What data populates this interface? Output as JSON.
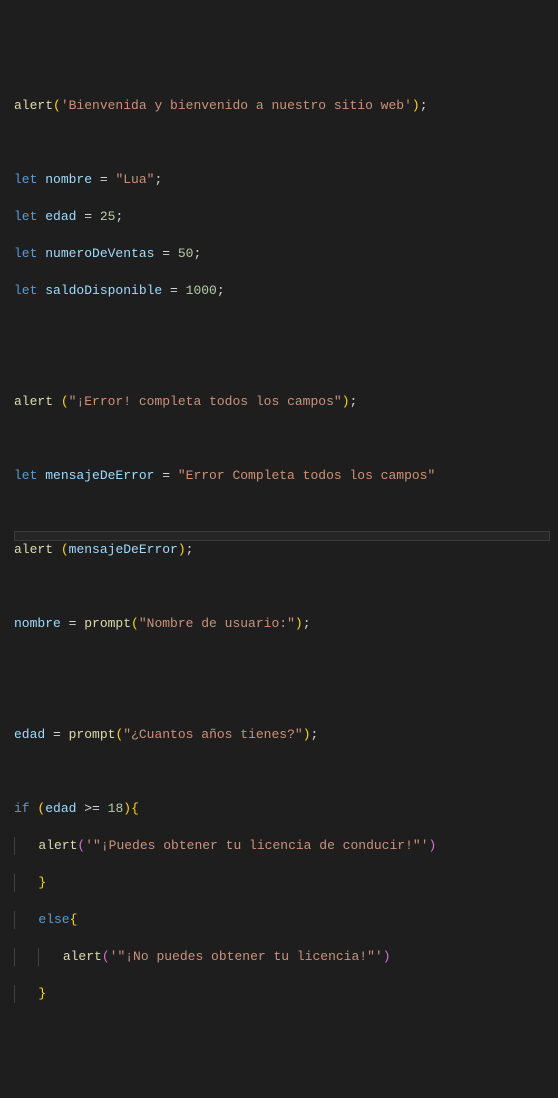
{
  "code": {
    "l1_fn": "alert",
    "l1_p1": "(",
    "l1_str": "'Bienvenida y bienvenido a nuestro sitio web'",
    "l1_p2": ")",
    "l1_s": ";",
    "l3_kw": "let",
    "l3_var": "nombre",
    "l3_eq": " = ",
    "l3_str": "\"Lua\"",
    "l3_s": ";",
    "l4_kw": "let",
    "l4_var": "edad",
    "l4_eq": " = ",
    "l4_num": "25",
    "l4_s": ";",
    "l5_kw": "let",
    "l5_var": "numeroDeVentas",
    "l5_eq": " = ",
    "l5_num": "50",
    "l5_s": ";",
    "l6_kw": "let",
    "l6_var": "saldoDisponible",
    "l6_eq": " = ",
    "l6_num": "1000",
    "l6_s": ";",
    "l9_fn": "alert",
    "l9_sp": " ",
    "l9_p1": "(",
    "l9_str": "\"¡Error! completa todos los campos\"",
    "l9_p2": ")",
    "l9_s": ";",
    "l11_kw": "let",
    "l11_var": "mensajeDeError",
    "l11_eq": " = ",
    "l11_str": "\"Error Completa todos los campos\"",
    "l13_fn": "alert",
    "l13_sp": " ",
    "l13_p1": "(",
    "l13_var": "mensajeDeError",
    "l13_p2": ")",
    "l13_s": ";",
    "l15_var": "nombre",
    "l15_eq": " = ",
    "l15_fn": "prompt",
    "l15_p1": "(",
    "l15_str": "\"Nombre de usuario:\"",
    "l15_p2": ")",
    "l15_s": ";",
    "l18_var": "edad",
    "l18_eq": " = ",
    "l18_fn": "prompt",
    "l18_p1": "(",
    "l18_str": "\"¿Cuantos años tienes?\"",
    "l18_p2": ")",
    "l18_s": ";",
    "l20_if": "if",
    "l20_sp": " ",
    "l20_p1": "(",
    "l20_var": "edad",
    "l20_op": " >= ",
    "l20_num": "18",
    "l20_p2": ")",
    "l20_b1": "{",
    "l21_fn": "alert",
    "l21_p1": "(",
    "l21_str": "'\"¡Puedes obtener tu licencia de conducir!\"'",
    "l21_p2": ")",
    "l22_b": "}",
    "l23_else": "else",
    "l23_b": "{",
    "l24_fn": "alert",
    "l24_p1": "(",
    "l24_str": "'\"¡No puedes obtener tu licencia!\"'",
    "l24_p2": ")",
    "l25_b": "}"
  }
}
